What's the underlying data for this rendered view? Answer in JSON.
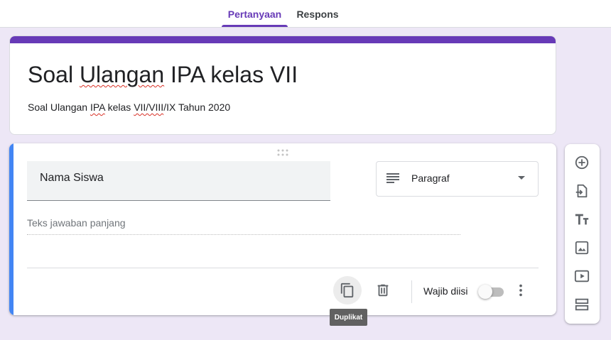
{
  "tabs": [
    {
      "label": "Pertanyaan",
      "active": true
    },
    {
      "label": "Respons",
      "active": false
    }
  ],
  "form": {
    "title_parts": [
      "Soal ",
      "Ulangan",
      " IPA kelas VII"
    ],
    "description_parts": [
      "Soal Ulangan ",
      "IPA",
      " kelas ",
      "VII/VIII",
      "/IX Tahun 2020"
    ],
    "accent_color": "#673ab7"
  },
  "question": {
    "title": "Nama Siswa",
    "type_label": "Paragraf",
    "answer_hint": "Teks jawaban panjang",
    "required_label": "Wajib diisi",
    "required": false,
    "active_bar_color": "#4285f4"
  },
  "footer_icons": [
    "duplicate-icon",
    "trash-icon",
    "more-vert-icon"
  ],
  "tooltip": "Duplikat",
  "side_toolbar": [
    "add-question-icon",
    "import-questions-icon",
    "add-title-icon",
    "add-image-icon",
    "add-video-icon",
    "add-section-icon"
  ]
}
